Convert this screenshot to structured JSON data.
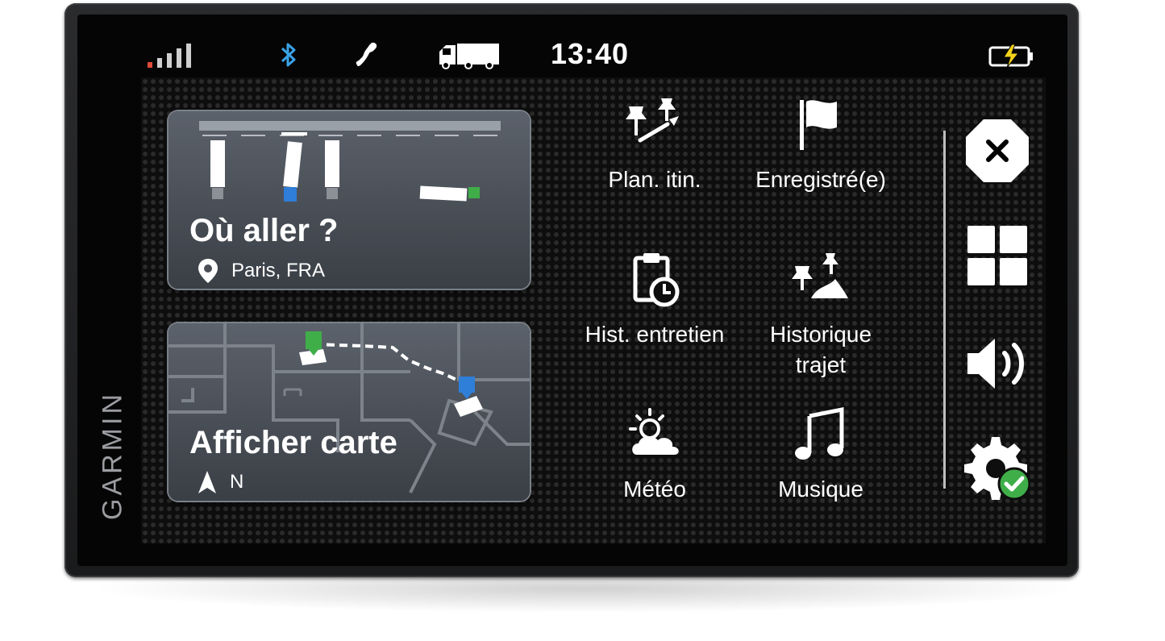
{
  "device": {
    "brand": "GARMIN"
  },
  "statusbar": {
    "time": "13:40",
    "icons": [
      "signal-strength-icon",
      "bluetooth-icon",
      "phone-icon",
      "truck-icon",
      "battery-charging-icon"
    ],
    "colors": {
      "bluetooth": "#3aa2e8",
      "signal_low_bar": "#e04a3a",
      "battery_bolt": "#f2d21a"
    }
  },
  "cards": {
    "where_to": {
      "title": "Où aller ?",
      "location": "Paris, FRA",
      "icon": "location-pin-icon"
    },
    "view_map": {
      "title": "Afficher carte",
      "heading": "N",
      "icon": "north-arrow-icon"
    }
  },
  "menu": [
    {
      "id": "trip-planner",
      "label": "Plan. itin.",
      "icon": "trip-planner-icon"
    },
    {
      "id": "saved",
      "label": "Enregistré(e)",
      "icon": "flag-icon"
    },
    {
      "id": "service-history",
      "label": "Hist. entretien",
      "icon": "clipboard-clock-icon"
    },
    {
      "id": "trip-history",
      "label_line1": "Historique",
      "label_line2": "trajet",
      "icon": "trip-history-icon"
    },
    {
      "id": "weather",
      "label": "Météo",
      "icon": "weather-icon"
    },
    {
      "id": "music",
      "label": "Musique",
      "icon": "music-note-icon"
    }
  ],
  "sidebar": [
    {
      "id": "close",
      "icon": "close-icon"
    },
    {
      "id": "apps",
      "icon": "grid-icon"
    },
    {
      "id": "volume",
      "icon": "volume-icon"
    },
    {
      "id": "settings",
      "icon": "settings-check-icon",
      "badge_color": "#3fae49"
    }
  ]
}
